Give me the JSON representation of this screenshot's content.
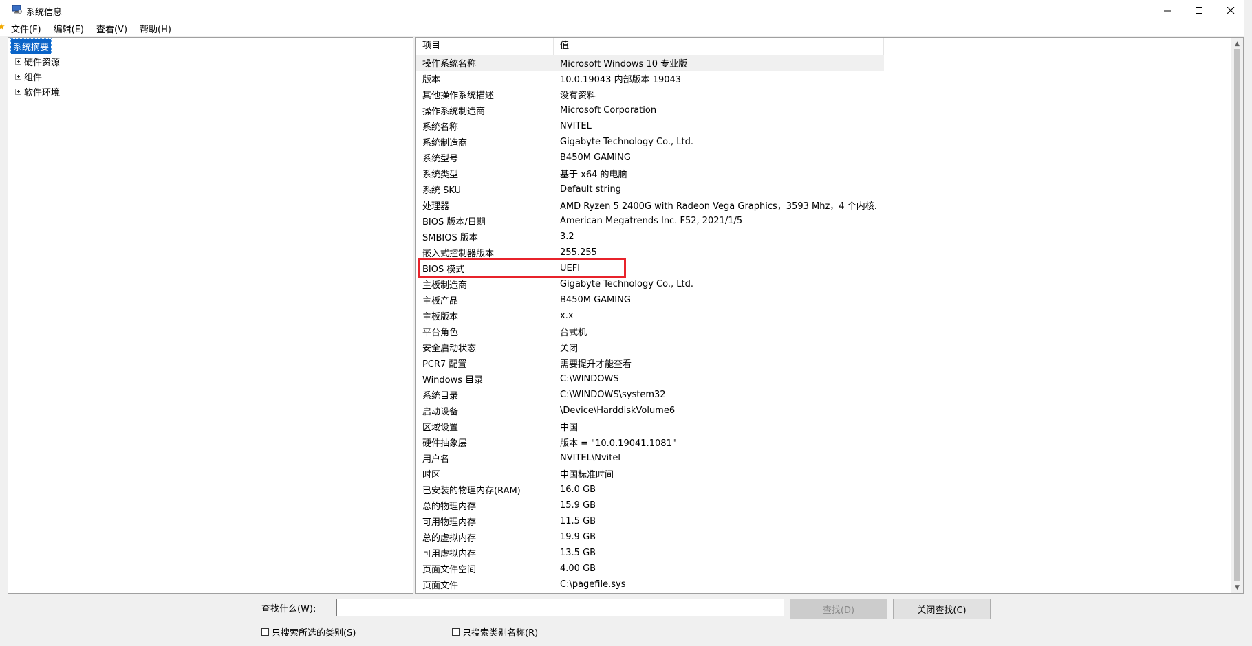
{
  "window": {
    "title": "系统信息",
    "controls": {
      "minimize": "—",
      "maximize": "☐",
      "close": "✕"
    }
  },
  "menu": [
    {
      "label": "文件(F)"
    },
    {
      "label": "编辑(E)"
    },
    {
      "label": "查看(V)"
    },
    {
      "label": "帮助(H)"
    }
  ],
  "tree": [
    {
      "label": "系统摘要",
      "selected": true
    },
    {
      "label": "硬件资源",
      "expandable": true
    },
    {
      "label": "组件",
      "expandable": true
    },
    {
      "label": "软件环境",
      "expandable": true
    }
  ],
  "table": {
    "headers": {
      "item": "项目",
      "value": "值"
    },
    "rows": [
      {
        "item": "操作系统名称",
        "value": "Microsoft Windows 10 专业版"
      },
      {
        "item": "版本",
        "value": "10.0.19043 内部版本 19043"
      },
      {
        "item": "其他操作系统描述",
        "value": "没有资料"
      },
      {
        "item": "操作系统制造商",
        "value": "Microsoft Corporation"
      },
      {
        "item": "系统名称",
        "value": "NVITEL"
      },
      {
        "item": "系统制造商",
        "value": "Gigabyte Technology Co., Ltd."
      },
      {
        "item": "系统型号",
        "value": "B450M GAMING"
      },
      {
        "item": "系统类型",
        "value": "基于 x64 的电脑"
      },
      {
        "item": "系统 SKU",
        "value": "Default string"
      },
      {
        "item": "处理器",
        "value": "AMD Ryzen 5 2400G with Radeon Vega Graphics，3593 Mhz，4 个内核..."
      },
      {
        "item": "BIOS 版本/日期",
        "value": "American Megatrends Inc. F52, 2021/1/5"
      },
      {
        "item": "SMBIOS 版本",
        "value": "3.2"
      },
      {
        "item": "嵌入式控制器版本",
        "value": "255.255"
      },
      {
        "item": "BIOS 模式",
        "value": "UEFI"
      },
      {
        "item": "主板制造商",
        "value": "Gigabyte Technology Co., Ltd."
      },
      {
        "item": "主板产品",
        "value": "B450M GAMING"
      },
      {
        "item": "主板版本",
        "value": "x.x"
      },
      {
        "item": "平台角色",
        "value": "台式机"
      },
      {
        "item": "安全启动状态",
        "value": "关闭"
      },
      {
        "item": "PCR7 配置",
        "value": "需要提升才能查看"
      },
      {
        "item": "Windows 目录",
        "value": "C:\\WINDOWS"
      },
      {
        "item": "系统目录",
        "value": "C:\\WINDOWS\\system32"
      },
      {
        "item": "启动设备",
        "value": "\\Device\\HarddiskVolume6"
      },
      {
        "item": "区域设置",
        "value": "中国"
      },
      {
        "item": "硬件抽象层",
        "value": "版本 = \"10.0.19041.1081\""
      },
      {
        "item": "用户名",
        "value": "NVITEL\\Nvitel"
      },
      {
        "item": "时区",
        "value": "中国标准时间"
      },
      {
        "item": "已安装的物理内存(RAM)",
        "value": "16.0 GB"
      },
      {
        "item": "总的物理内存",
        "value": "15.9 GB"
      },
      {
        "item": "可用物理内存",
        "value": "11.5 GB"
      },
      {
        "item": "总的虚拟内存",
        "value": "19.9 GB"
      },
      {
        "item": "可用虚拟内存",
        "value": "13.5 GB"
      },
      {
        "item": "页面文件空间",
        "value": "4.00 GB"
      },
      {
        "item": "页面文件",
        "value": "C:\\pagefile.sys"
      }
    ],
    "highlighted_item": "BIOS 模式"
  },
  "find": {
    "label": "查找什么(W):",
    "input_value": "",
    "find_button": "查找(D)",
    "close_find_button": "关闭查找(C)",
    "check_selected_category": "只搜索所选的类别(S)",
    "check_category_names": "只搜索类别名称(R)"
  },
  "colors": {
    "selection": "#0a64c8",
    "highlight_box": "#e8232b"
  }
}
